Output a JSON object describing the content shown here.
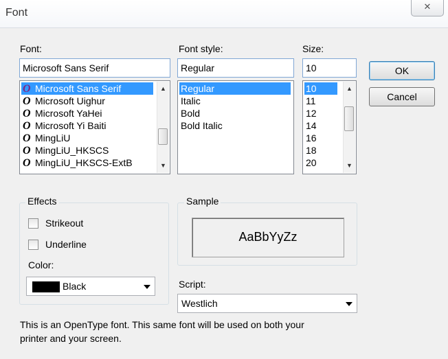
{
  "window": {
    "title": "Font",
    "close_glyph": "✕"
  },
  "font": {
    "label": "Font:",
    "value": "Microsoft Sans Serif",
    "items": [
      {
        "name": "Microsoft Sans Serif",
        "selected": true
      },
      {
        "name": "Microsoft Uighur",
        "selected": false
      },
      {
        "name": "Microsoft YaHei",
        "selected": false
      },
      {
        "name": "Microsoft Yi Baiti",
        "selected": false
      },
      {
        "name": "MingLiU",
        "selected": false
      },
      {
        "name": "MingLiU_HKSCS",
        "selected": false
      },
      {
        "name": "MingLiU_HKSCS-ExtB",
        "selected": false
      }
    ],
    "glyph": "O"
  },
  "style": {
    "label": "Font style:",
    "value": "Regular",
    "items": [
      {
        "name": "Regular",
        "selected": true
      },
      {
        "name": "Italic",
        "selected": false
      },
      {
        "name": "Bold",
        "selected": false
      },
      {
        "name": "Bold Italic",
        "selected": false
      }
    ]
  },
  "size": {
    "label": "Size:",
    "value": "10",
    "items": [
      {
        "name": "10",
        "selected": true
      },
      {
        "name": "11",
        "selected": false
      },
      {
        "name": "12",
        "selected": false
      },
      {
        "name": "14",
        "selected": false
      },
      {
        "name": "16",
        "selected": false
      },
      {
        "name": "18",
        "selected": false
      },
      {
        "name": "20",
        "selected": false
      }
    ]
  },
  "buttons": {
    "ok": "OK",
    "cancel": "Cancel"
  },
  "effects": {
    "title": "Effects",
    "strikeout": "Strikeout",
    "underline": "Underline",
    "color_label": "Color:",
    "color_value": "Black",
    "color_hex": "#000000"
  },
  "sample": {
    "title": "Sample",
    "text": "AaBbYyZz"
  },
  "script": {
    "label": "Script:",
    "value": "Westlich"
  },
  "info": {
    "line1": "This is an OpenType font. This same font will be used on both your",
    "line2": "printer and your screen."
  },
  "colors": {
    "selection": "#3399ff",
    "dialog_bg": "#f0f0f0"
  }
}
